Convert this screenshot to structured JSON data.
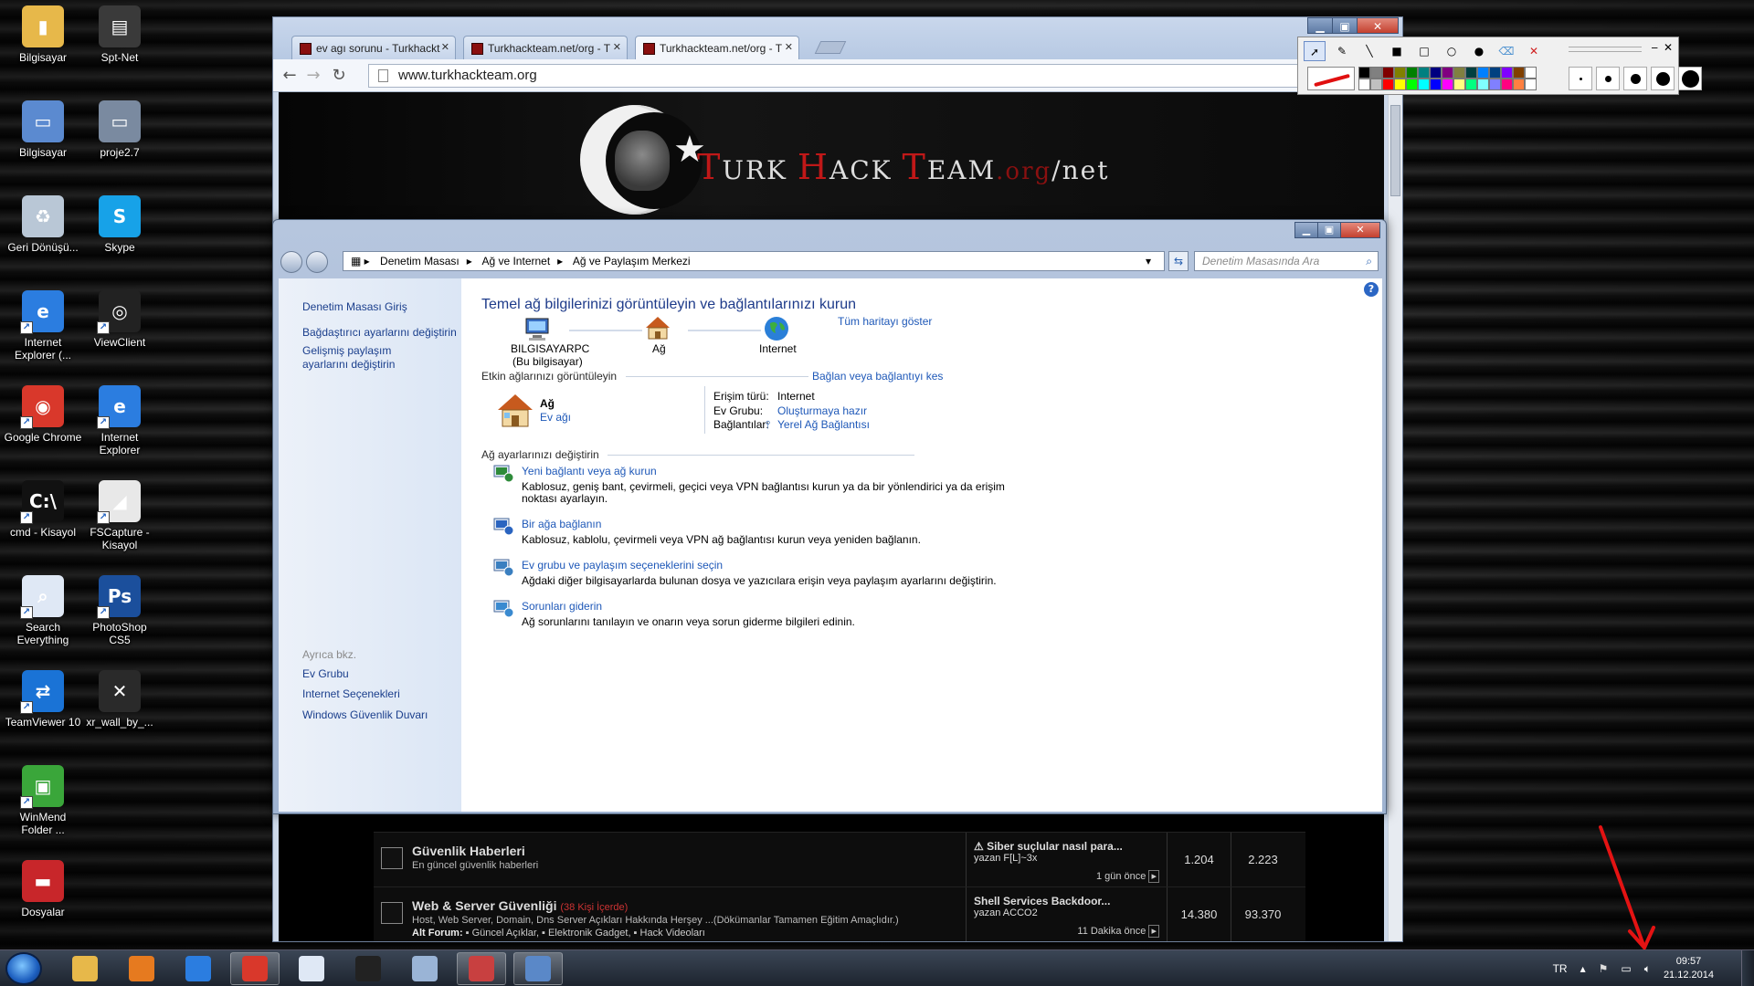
{
  "desktop": {
    "icons": [
      {
        "label": "Bilgisayar",
        "name": "folder-icon",
        "col": 0,
        "row": 0,
        "color": "#e7b84a",
        "glyph": "▮",
        "shortcut": false
      },
      {
        "label": "Spt-Net",
        "name": "spt-net-icon",
        "col": 1,
        "row": 0,
        "color": "#3a3a3a",
        "glyph": "▤",
        "shortcut": false
      },
      {
        "label": "Bilgisayar",
        "name": "computer-icon",
        "col": 0,
        "row": 1,
        "color": "#5b8ad0",
        "glyph": "▭",
        "shortcut": false
      },
      {
        "label": "proje2.7",
        "name": "laptop-icon",
        "col": 1,
        "row": 1,
        "color": "#7a8aa0",
        "glyph": "▭",
        "shortcut": false
      },
      {
        "label": "Geri Dönüşü...",
        "name": "recycle-bin-icon",
        "col": 0,
        "row": 2,
        "color": "#b9c7d6",
        "glyph": "♻",
        "shortcut": false
      },
      {
        "label": "Skype",
        "name": "skype-icon",
        "col": 1,
        "row": 2,
        "color": "#17a2e8",
        "glyph": "S",
        "shortcut": false
      },
      {
        "label": "Internet Explorer (...",
        "name": "internet-explorer-icon",
        "col": 0,
        "row": 3,
        "color": "#2b7de0",
        "glyph": "e",
        "shortcut": true
      },
      {
        "label": "ViewClient",
        "name": "viewclient-icon",
        "col": 1,
        "row": 3,
        "color": "#222",
        "glyph": "◎",
        "shortcut": true
      },
      {
        "label": "Google Chrome",
        "name": "chrome-icon",
        "col": 0,
        "row": 4,
        "color": "#d9382b",
        "glyph": "◉",
        "shortcut": true
      },
      {
        "label": "Internet Explorer",
        "name": "internet-explorer-icon",
        "col": 1,
        "row": 4,
        "color": "#2b7de0",
        "glyph": "e",
        "shortcut": true
      },
      {
        "label": "cmd - Kisayol",
        "name": "cmd-icon",
        "col": 0,
        "row": 5,
        "color": "#111",
        "glyph": "C:\\",
        "shortcut": true
      },
      {
        "label": "FSCapture - Kisayol",
        "name": "fscapture-icon",
        "col": 1,
        "row": 5,
        "color": "#e8e8e8",
        "glyph": "◢",
        "shortcut": true
      },
      {
        "label": "Search Everything",
        "name": "search-everything-icon",
        "col": 0,
        "row": 6,
        "color": "#dfe8f5",
        "glyph": "⌕",
        "shortcut": true
      },
      {
        "label": "PhotoShop CS5",
        "name": "photoshop-icon",
        "col": 1,
        "row": 6,
        "color": "#1b4f9c",
        "glyph": "Ps",
        "shortcut": true
      },
      {
        "label": "TeamViewer 10",
        "name": "teamviewer-icon",
        "col": 0,
        "row": 7,
        "color": "#1a73d6",
        "glyph": "⇄",
        "shortcut": true
      },
      {
        "label": "xr_wall_by_...",
        "name": "wallpaper-file-icon",
        "col": 1,
        "row": 7,
        "color": "#2a2a2a",
        "glyph": "✕",
        "shortcut": false
      },
      {
        "label": "WinMend Folder ...",
        "name": "winmend-icon",
        "col": 0,
        "row": 8,
        "color": "#3aa63a",
        "glyph": "▣",
        "shortcut": true
      },
      {
        "label": "Dosyalar",
        "name": "toolbox-icon",
        "col": 0,
        "row": 9,
        "color": "#c8262a",
        "glyph": "▬",
        "shortcut": false
      }
    ]
  },
  "browser": {
    "tabs": [
      {
        "title": "ev agı sorunu - Turkhackt"
      },
      {
        "title": "Turkhackteam.net/org - T"
      },
      {
        "title": "Turkhackteam.net/org - T"
      }
    ],
    "url": "www.turkhackteam.org",
    "logo": {
      "t1": "T",
      "t1b": "URK ",
      "t2": "H",
      "t2b": "ACK ",
      "t3": "T",
      "t3b": "EAM",
      "org": ".org",
      "net": "/net"
    },
    "forum_rows": [
      {
        "title": "Güvenlik Haberleri",
        "count": "",
        "desc": "En güncel güvenlik haberleri",
        "sub_label": "",
        "sub": "",
        "last_title": "⚠ Siber suçlular nasıl para...",
        "last_by": "yazan F[L]~3x",
        "ago": "1 gün önce",
        "n1": "1.204",
        "n2": "2.223"
      },
      {
        "title": "Web & Server Güvenliği",
        "count": "(38 Kişi İçerde)",
        "desc": "Host, Web Server, Domain, Dns Server Açıkları Hakkında Herşey ...(Dökümanlar Tamamen Eğitim Amaçlıdır.)",
        "sub_label": "Alt Forum:",
        "sub": "▪ Güncel Açıklar, ▪ Elektronik Gadget, ▪ Hack Videoları",
        "last_title": "Shell Services Backdoor...",
        "last_by": "yazan ACCO2",
        "ago": "11 Dakika önce",
        "n1": "14.380",
        "n2": "93.370"
      }
    ]
  },
  "control_panel": {
    "breadcrumb": [
      "Denetim Masası",
      "Ağ ve Internet",
      "Ağ ve Paylaşım Merkezi"
    ],
    "search_placeholder": "Denetim Masasında Ara",
    "left": {
      "home": "Denetim Masası Giriş",
      "adapter": "Bağdaştırıcı ayarlarını değiştirin",
      "advanced": "Gelişmiş paylaşım ayarlarını değiştirin",
      "see_also": "Ayrıca bkz.",
      "homegroup": "Ev Grubu",
      "inet_options": "Internet Seçenekleri",
      "firewall": "Windows Güvenlik Duvarı"
    },
    "main": {
      "heading": "Temel ağ bilgilerinizi görüntüleyin ve bağlantılarınızı kurun",
      "show_map": "Tüm haritayı göster",
      "node1": "BILGISAYARPC",
      "node1_sub": "(Bu bilgisayar)",
      "node2": "Ağ",
      "node3": "Internet",
      "active_title": "Etkin ağlarınızı görüntüleyin",
      "disconnect": "Bağlan veya bağlantıyı kes",
      "net_name": "Ağ",
      "net_type": "Ev ağı",
      "access_label": "Erişim türü:",
      "access_val": "Internet",
      "homegroup_label": "Ev Grubu:",
      "homegroup_val": "Oluşturmaya hazır",
      "conn_label": "Bağlantılar:",
      "conn_val": "Yerel Ağ Bağlantısı",
      "change_title": "Ağ ayarlarınızı değiştirin",
      "tasks": [
        {
          "title": "Yeni bağlantı veya ağ kurun",
          "desc1": "Kablosuz, geniş bant, çevirmeli, geçici veya VPN bağlantısı kurun ya da bir yönlendirici ya da erişim",
          "desc2": "noktası ayarlayın."
        },
        {
          "title": "Bir ağa bağlanın",
          "desc1": "Kablosuz, kablolu, çevirmeli veya VPN ağ bağlantısı kurun veya yeniden bağlanın.",
          "desc2": ""
        },
        {
          "title": "Ev grubu ve paylaşım seçeneklerini seçin",
          "desc1": "Ağdaki diğer bilgisayarlarda bulunan dosya ve yazıcılara erişin veya paylaşım ayarlarını değiştirin.",
          "desc2": ""
        },
        {
          "title": "Sorunları giderin",
          "desc1": "Ağ sorunlarını tanılayın ve onarın veya sorun giderme bilgileri edinin.",
          "desc2": ""
        }
      ]
    }
  },
  "paint_toolbar": {
    "palette": [
      "#000000",
      "#808080",
      "#800000",
      "#808000",
      "#008000",
      "#008080",
      "#000080",
      "#800080",
      "#808040",
      "#004040",
      "#0080ff",
      "#004080",
      "#8000ff",
      "#804000",
      "#ffffff",
      "#ffffff",
      "#c0c0c0",
      "#ff0000",
      "#ffff00",
      "#00ff00",
      "#00ffff",
      "#0000ff",
      "#ff00ff",
      "#ffff80",
      "#00ff80",
      "#80ffff",
      "#8080ff",
      "#ff0080",
      "#ff8040",
      "#ffffff"
    ],
    "brush_sizes": [
      3,
      7,
      11,
      15,
      19
    ]
  },
  "taskbar": {
    "apps": [
      {
        "name": "explorer-taskbar-icon",
        "color": "#e7b84a",
        "open": false
      },
      {
        "name": "media-player-taskbar-icon",
        "color": "#e67a1f",
        "open": false
      },
      {
        "name": "ie-taskbar-icon",
        "color": "#2b7de0",
        "open": false
      },
      {
        "name": "chrome-taskbar-icon",
        "color": "#d9382b",
        "open": true
      },
      {
        "name": "search-taskbar-icon",
        "color": "#dfe8f5",
        "open": false
      },
      {
        "name": "viewclient-taskbar-icon",
        "color": "#222",
        "open": false
      },
      {
        "name": "dvd-taskbar-icon",
        "color": "#9ab4d6",
        "open": false
      },
      {
        "name": "paint-taskbar-icon",
        "color": "#c84040",
        "open": true
      },
      {
        "name": "control-panel-taskbar-icon",
        "color": "#5a88c8",
        "open": true
      }
    ],
    "lang": "TR",
    "time": "09:57",
    "date": "21.12.2014"
  }
}
